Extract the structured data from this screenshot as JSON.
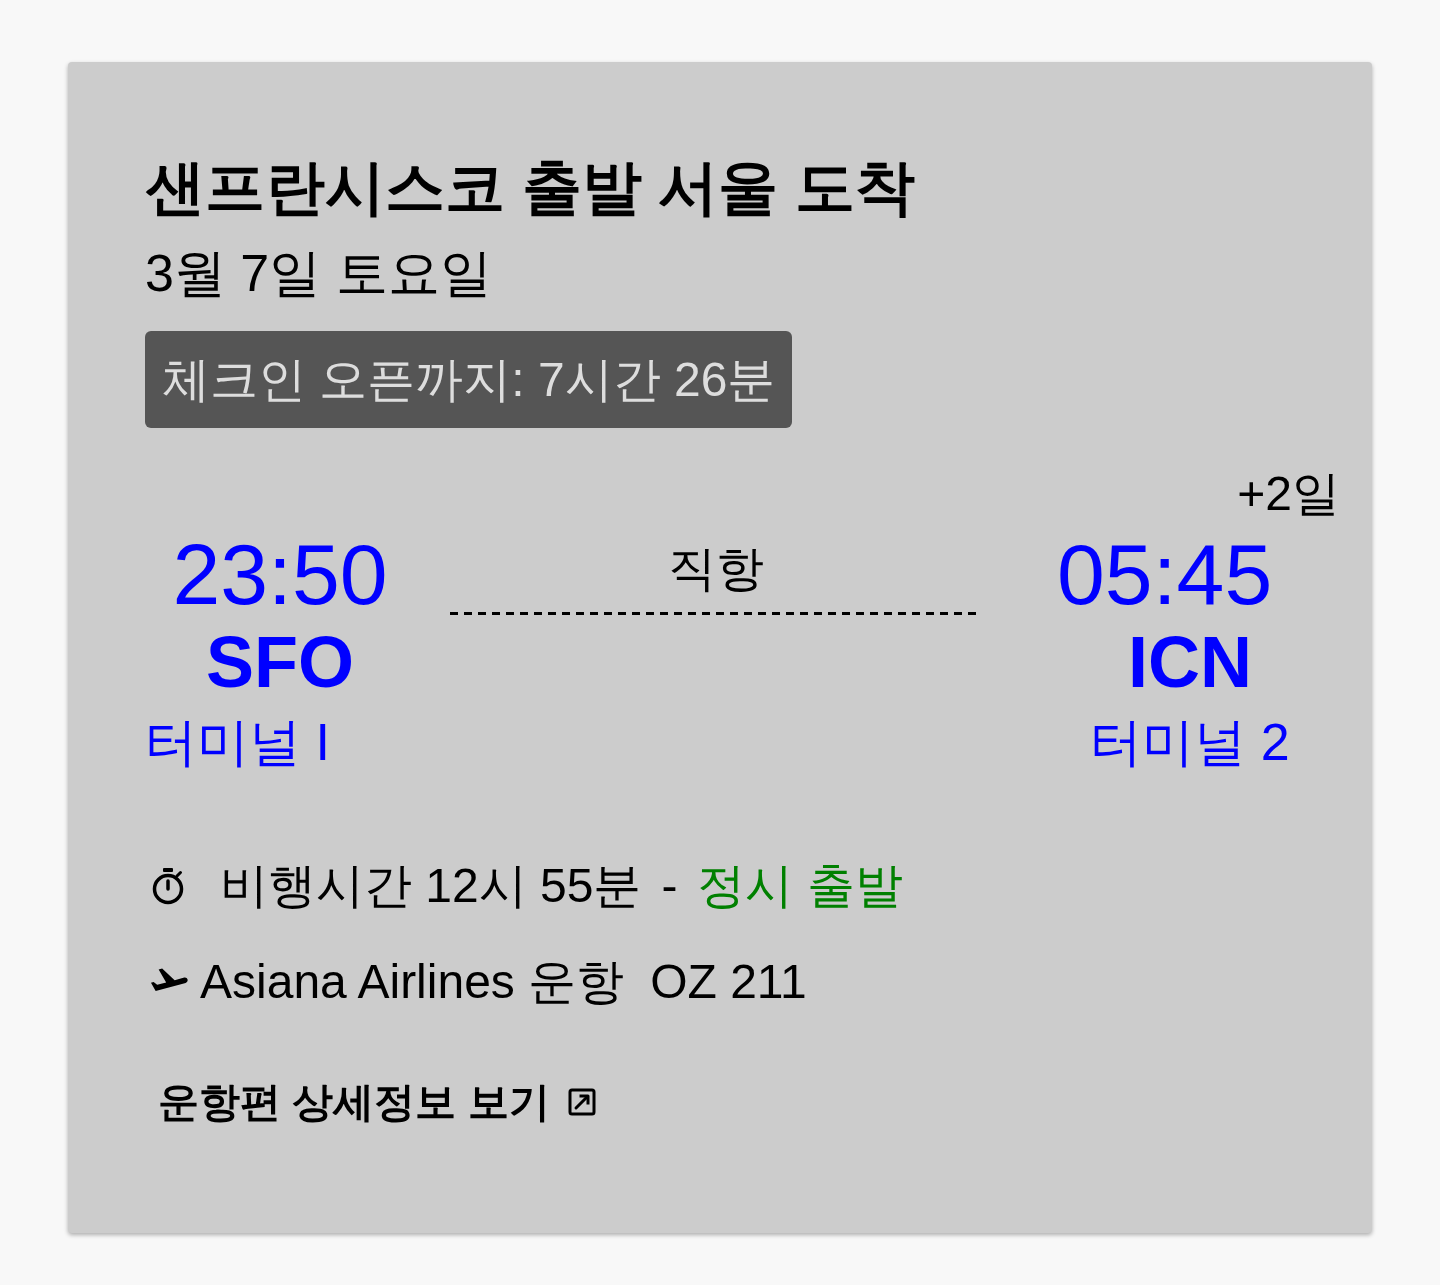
{
  "card": {
    "title": "샌프란시스코 출발 서울 도착",
    "date": "3월 7일 토요일",
    "checkin_badge": "체크인 오픈까지: 7시간 26분"
  },
  "flight": {
    "departure": {
      "time": "23:50",
      "airport": "SFO",
      "terminal": "터미널 I"
    },
    "stops": "직항",
    "arrival": {
      "day_offset": "+2일",
      "time": "05:45",
      "airport": "ICN",
      "terminal": "터미널 2"
    }
  },
  "details": {
    "duration": "비행시간 12시 55분",
    "separator": "-",
    "status": "정시 출발",
    "operator": "Asiana Airlines 운항",
    "flight_number": "OZ 211"
  },
  "link": {
    "label": "운항편 상세정보 보기"
  }
}
